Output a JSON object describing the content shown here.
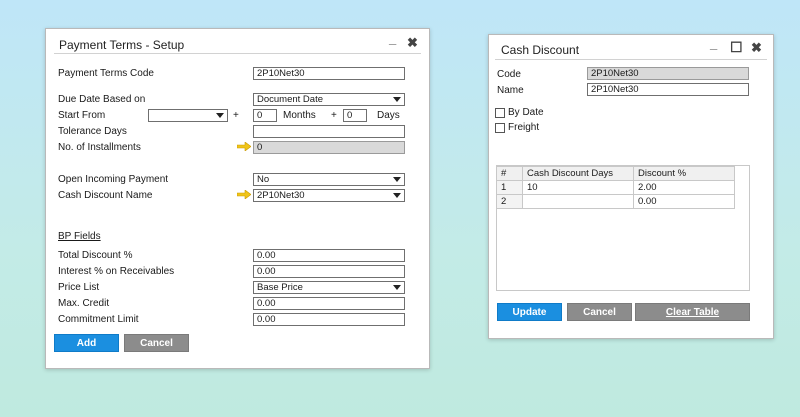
{
  "payment_terms": {
    "title": "Payment Terms - Setup",
    "minimize": "_",
    "close": "✖",
    "fields": {
      "code_label": "Payment Terms Code",
      "code_value": "2P10Net30",
      "due_date_label": "Due Date Based on",
      "due_date_value": "Document Date",
      "start_from_label": "Start From",
      "start_from_value": "",
      "plus1": "+",
      "months_value": "0",
      "months_label": "Months",
      "plus2": "+",
      "days_value": "0",
      "days_label": "Days",
      "tolerance_label": "Tolerance Days",
      "tolerance_value": "",
      "installments_label": "No. of Installments",
      "installments_value": "0",
      "open_incoming_label": "Open Incoming Payment",
      "open_incoming_value": "No",
      "cash_discount_name_label": "Cash Discount Name",
      "cash_discount_name_value": "2P10Net30"
    },
    "bp_fields": {
      "heading": "BP Fields",
      "total_discount_label": "Total Discount %",
      "total_discount_value": "0.00",
      "interest_label": "Interest % on Receivables",
      "interest_value": "0.00",
      "price_list_label": "Price List",
      "price_list_value": "Base Price",
      "max_credit_label": "Max. Credit",
      "max_credit_value": "0.00",
      "commitment_label": "Commitment Limit",
      "commitment_value": "0.00"
    },
    "buttons": {
      "add": "Add",
      "cancel": "Cancel"
    }
  },
  "cash_discount": {
    "title": "Cash Discount",
    "minimize": "_",
    "maximize": "☐",
    "close": "✖",
    "code_label": "Code",
    "code_value": "2P10Net30",
    "name_label": "Name",
    "name_value": "2P10Net30",
    "by_date_label": "By Date",
    "freight_label": "Freight",
    "table": {
      "headers": [
        "#",
        "Cash Discount Days",
        "Discount %"
      ],
      "rows": [
        [
          "1",
          "10",
          "2.00"
        ],
        [
          "2",
          "",
          "0.00"
        ]
      ]
    },
    "buttons": {
      "update": "Update",
      "cancel": "Cancel",
      "clear_table": "Clear Table"
    }
  },
  "colors": {
    "primary_button": "#1b8fe0",
    "gray_button": "#8c8c8c",
    "link_arrow": "#f0c419"
  }
}
